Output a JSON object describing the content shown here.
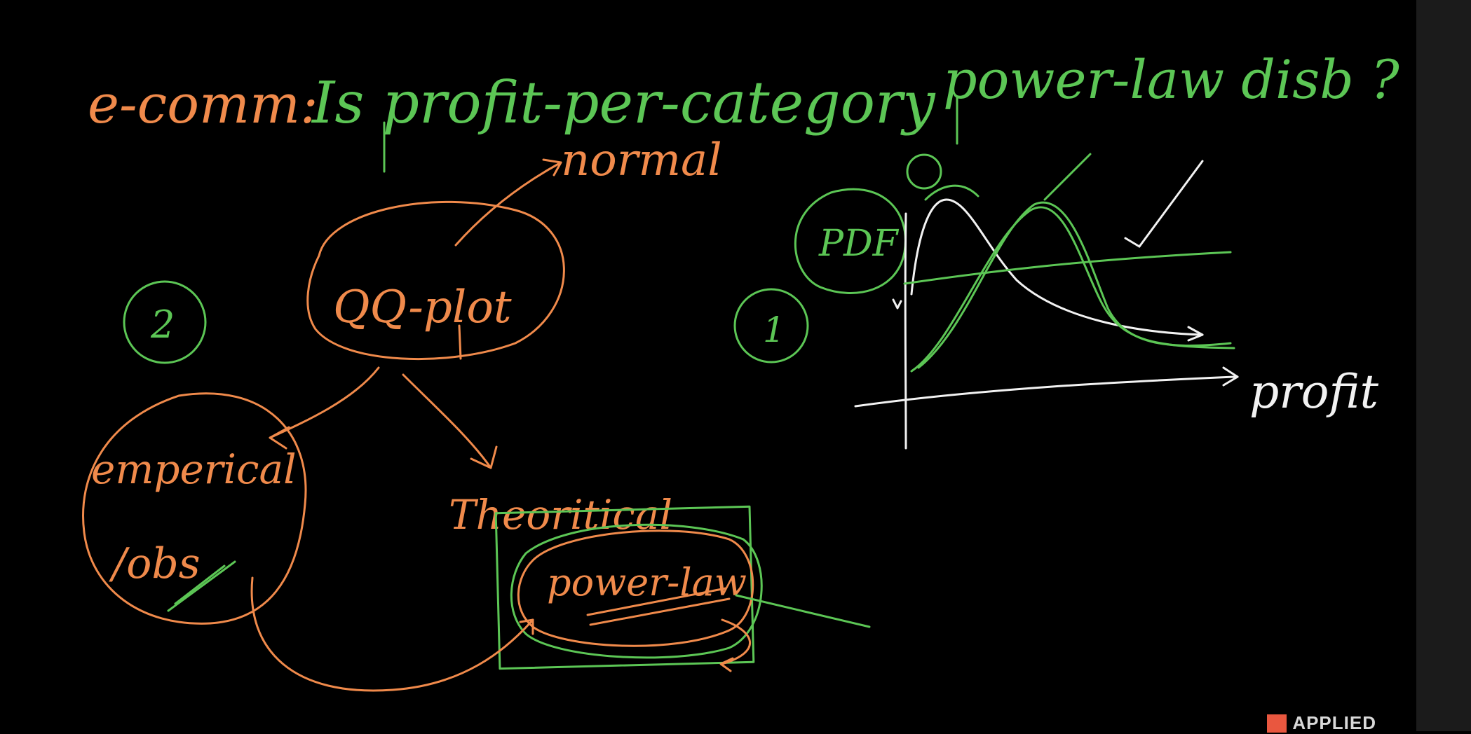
{
  "title": {
    "prefix": "e-comm:",
    "question": "Is profit-per-category",
    "suffix": "power-law disb ?"
  },
  "nodes": {
    "normal": "normal",
    "qq_plot": "QQ-plot",
    "empirical": "emperical",
    "obs": "/obs",
    "theoretical": "Theoritical",
    "power_law": "power-law",
    "pdf": "PDF",
    "profit_axis": "profit",
    "step_one": "1",
    "step_two": "2"
  },
  "logo": {
    "text": "APPLIED"
  },
  "colors": {
    "background": "#000000",
    "orange_ink": "#f08a4b",
    "green_ink": "#5cc655",
    "white_ink": "#f2f2f2"
  }
}
